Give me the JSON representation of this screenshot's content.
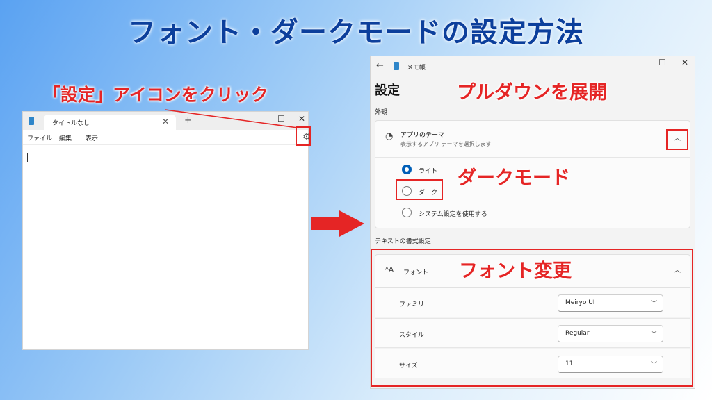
{
  "page_title": "フォント・ダークモードの設定方法",
  "annotations": {
    "click_settings": "「設定」アイコンをクリック",
    "expand_dropdown": "プルダウンを展開",
    "dark_mode": "ダークモード",
    "font_change": "フォント変更"
  },
  "notepad": {
    "tab_title": "タイトルなし",
    "tab_close": "✕",
    "new_tab": "+",
    "controls": {
      "minimize": "—",
      "maximize": "☐",
      "close": "✕"
    },
    "menu": [
      "ファイル",
      "編集",
      "表示"
    ],
    "settings_icon": "gear-icon"
  },
  "settings": {
    "app_title": "メモ帳",
    "back_icon": "←",
    "controls": {
      "minimize": "—",
      "maximize": "☐",
      "close": "✕"
    },
    "heading": "設定",
    "appearance": {
      "section_label": "外観",
      "card_title": "アプリのテーマ",
      "card_subtitle": "表示するアプリ テーマを選択します",
      "chevron": "︿",
      "options": [
        {
          "label": "ライト",
          "selected": true
        },
        {
          "label": "ダーク",
          "selected": false
        },
        {
          "label": "システム設定を使用する",
          "selected": false
        }
      ]
    },
    "text_format": {
      "section_label": "テキストの書式設定",
      "font_icon": "ᴬA",
      "font_title": "フォント",
      "chevron": "︿",
      "rows": [
        {
          "label": "ファミリ",
          "value": "Meiryo UI"
        },
        {
          "label": "スタイル",
          "value": "Regular"
        },
        {
          "label": "サイズ",
          "value": "11"
        }
      ],
      "dropdown_chevron": "﹀"
    }
  },
  "colors": {
    "accent_red": "#e52525",
    "title_blue": "#0c3f9c",
    "radio_blue": "#005fb8"
  }
}
